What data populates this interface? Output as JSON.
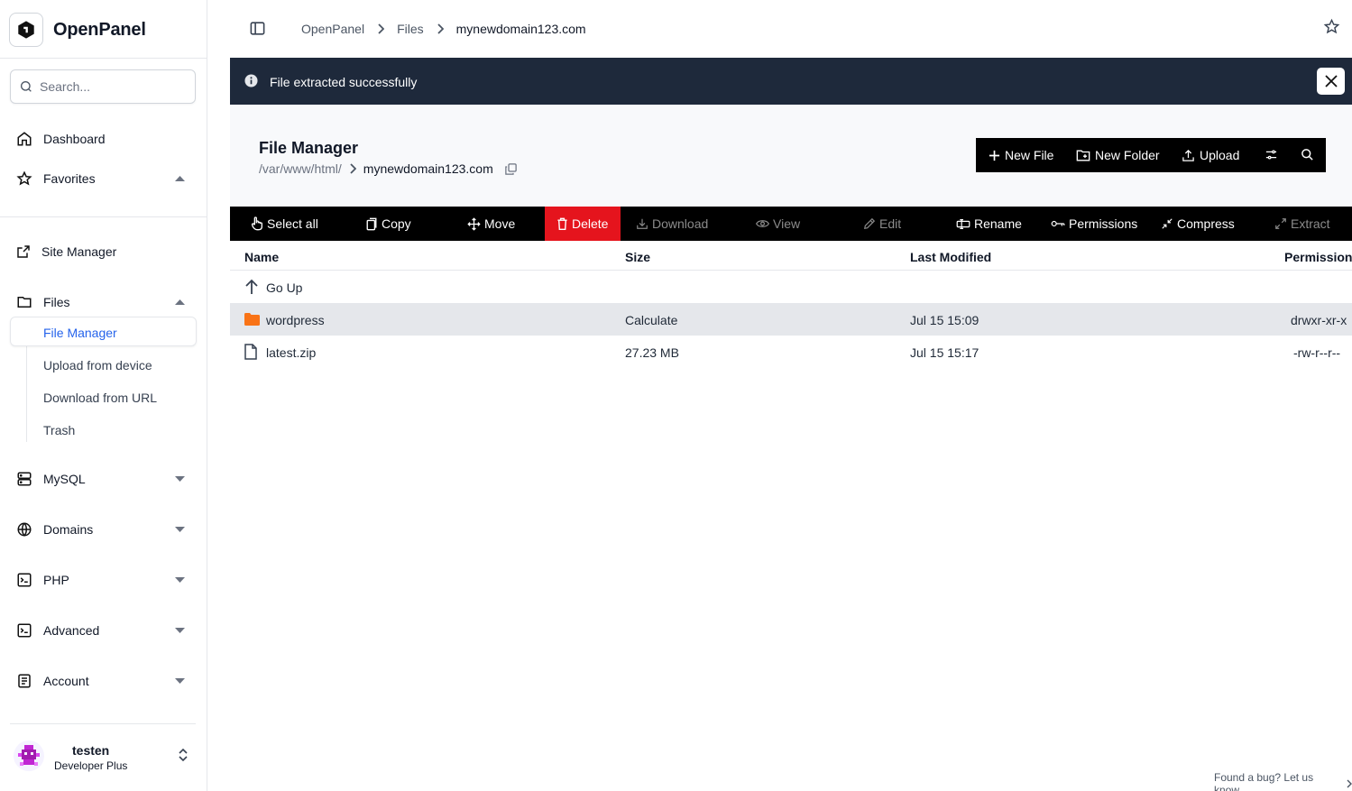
{
  "app": {
    "name": "OpenPanel"
  },
  "search": {
    "placeholder": "Search..."
  },
  "nav": {
    "dashboard": "Dashboard",
    "favorites": "Favorites",
    "site_manager": "Site Manager",
    "files": "Files",
    "files_sub": {
      "file_manager": "File Manager",
      "upload": "Upload from device",
      "download": "Download from URL",
      "trash": "Trash"
    },
    "mysql": "MySQL",
    "domains": "Domains",
    "php": "PHP",
    "advanced": "Advanced",
    "account": "Account"
  },
  "user": {
    "name": "testen",
    "plan": "Developer Plus"
  },
  "breadcrumb": {
    "root": "OpenPanel",
    "section": "Files",
    "current": "mynewdomain123.com"
  },
  "alert": {
    "message": "File extracted successfully"
  },
  "file_manager": {
    "title": "File Manager",
    "path_prefix": "/var/www/html/",
    "path_current": "mynewdomain123.com",
    "actions": {
      "new_file": "New File",
      "new_folder": "New Folder",
      "upload": "Upload"
    }
  },
  "toolbar": {
    "select_all": "Select all",
    "copy": "Copy",
    "move": "Move",
    "delete": "Delete",
    "download": "Download",
    "view": "View",
    "edit": "Edit",
    "rename": "Rename",
    "permissions": "Permissions",
    "compress": "Compress",
    "extract": "Extract"
  },
  "table": {
    "headers": {
      "name": "Name",
      "size": "Size",
      "modified": "Last Modified",
      "permissions": "Permissions"
    },
    "go_up": "Go Up",
    "rows": [
      {
        "name": "wordpress",
        "type": "folder",
        "size": "Calculate",
        "modified": "Jul 15 15:09",
        "permissions": "drwxr-xr-x"
      },
      {
        "name": "latest.zip",
        "type": "file",
        "size": "27.23 MB",
        "modified": "Jul 15 15:17",
        "permissions": "-rw-r--r--"
      }
    ]
  },
  "footer": {
    "bug_link": "Found a bug? Let us know"
  },
  "colors": {
    "delete": "#e5141d",
    "active_link": "#2563eb",
    "folder": "#f97316",
    "alert_bg": "#1e293b"
  }
}
